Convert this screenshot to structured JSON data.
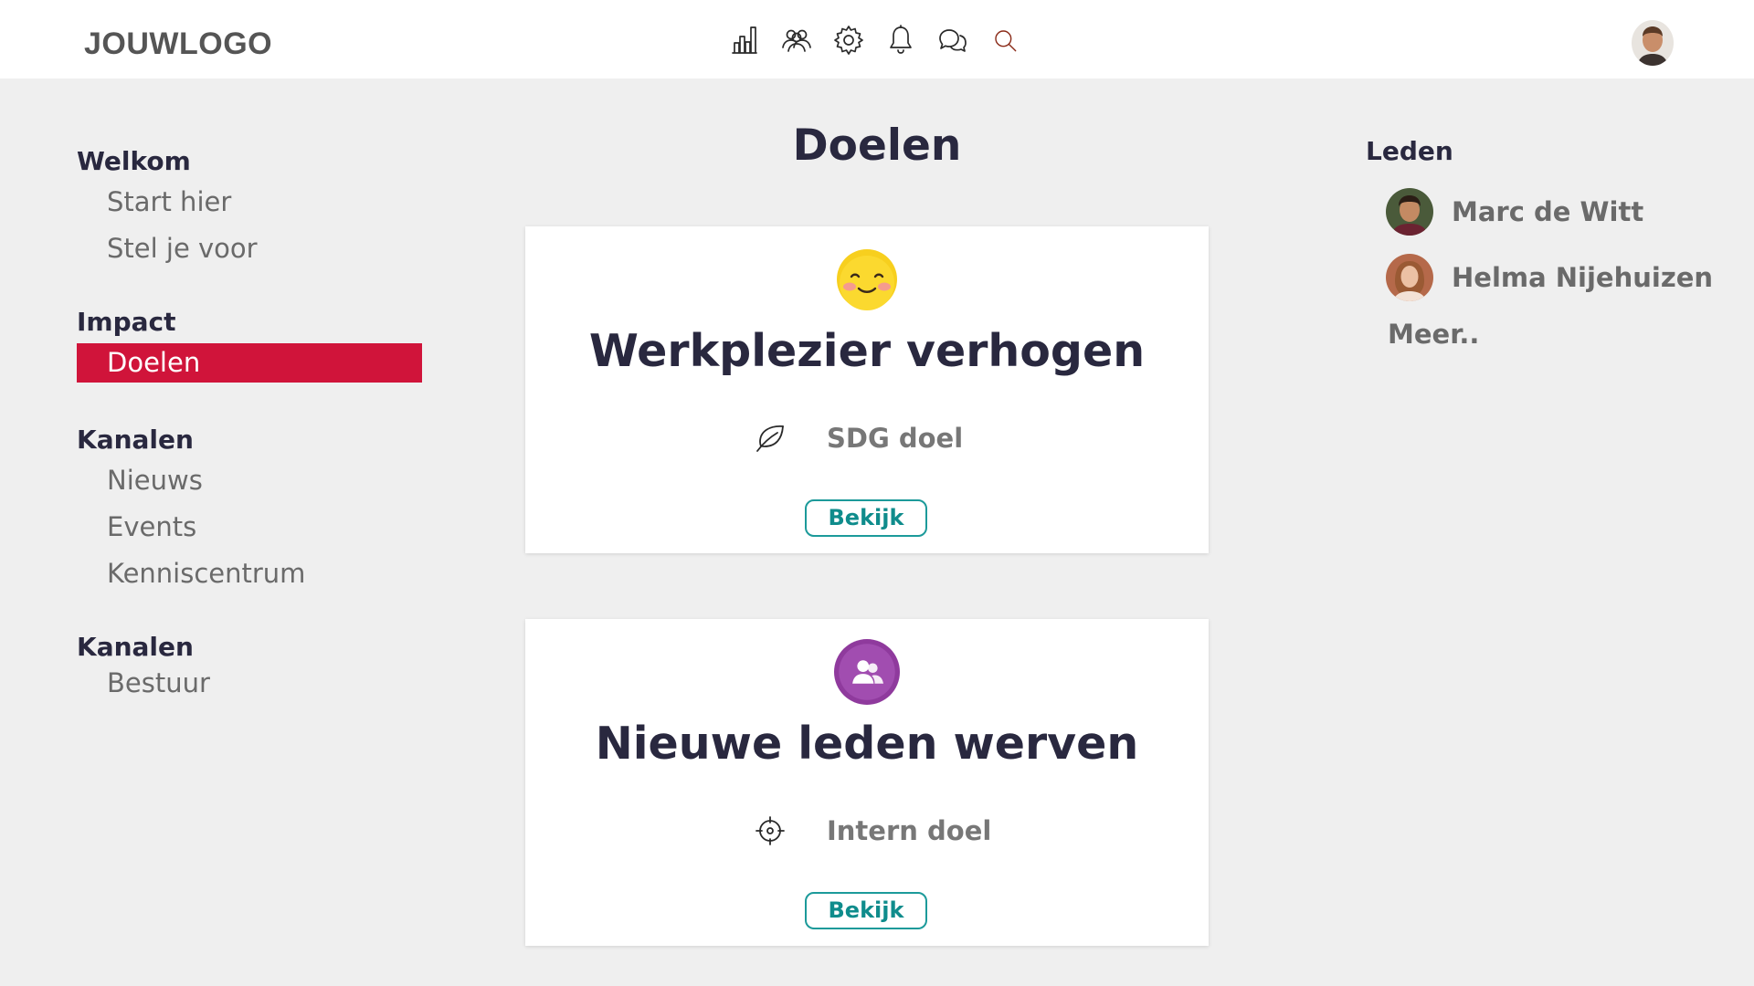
{
  "header": {
    "logo": "JOUWLOGO",
    "icons": [
      "chart-icon",
      "users-icon",
      "gear-icon",
      "bell-icon",
      "chat-icon",
      "search-icon"
    ]
  },
  "sidebar": {
    "sections": [
      {
        "title": "Welkom",
        "items": [
          "Start hier",
          "Stel je voor"
        ]
      },
      {
        "title": "Impact",
        "items": [
          "Doelen"
        ],
        "active": "Doelen"
      },
      {
        "title": "Kanalen",
        "items": [
          "Nieuws",
          "Events",
          "Kenniscentrum"
        ]
      },
      {
        "title": "Kanalen",
        "items": [
          "Bestuur"
        ]
      }
    ]
  },
  "main": {
    "title": "Doelen",
    "cards": [
      {
        "icon": "smiley-icon",
        "title": "Werkplezier verhogen",
        "type_icon": "leaf-icon",
        "type": "SDG doel",
        "button": "Bekijk"
      },
      {
        "icon": "group-icon",
        "title": "Nieuwe leden werven",
        "type_icon": "target-icon",
        "type": "Intern doel",
        "button": "Bekijk"
      }
    ]
  },
  "members": {
    "title": "Leden",
    "list": [
      "Marc de Witt",
      "Helma Nijehuizen"
    ],
    "more": "Meer.."
  },
  "colors": {
    "accent": "#d0143a",
    "button": "#1c9a9a",
    "heading": "#29283f",
    "muted": "#6a6a6a",
    "background": "#efefef"
  }
}
